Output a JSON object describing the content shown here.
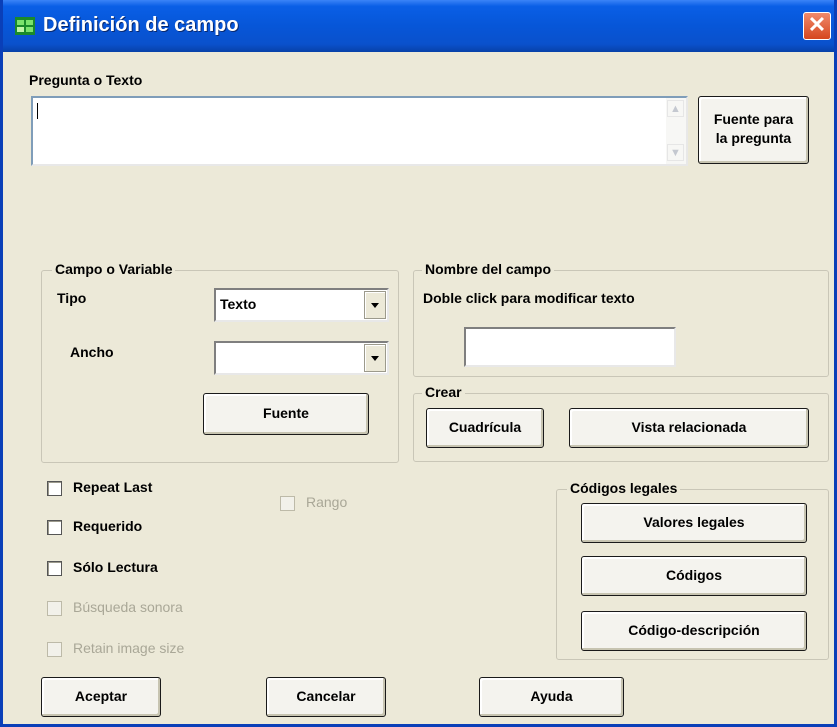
{
  "window": {
    "title": "Definición de campo",
    "close_glyph": "✕"
  },
  "question": {
    "label": "Pregunta o Texto",
    "value": "",
    "font_button_line1": "Fuente para",
    "font_button_line2": "la pregunta"
  },
  "field_group": {
    "legend": "Campo o Variable",
    "type_label": "Tipo",
    "type_value": "Texto",
    "width_label": "Ancho",
    "width_value": "",
    "font_button": "Fuente"
  },
  "name_group": {
    "legend": "Nombre del campo",
    "hint": "Doble click para modificar texto",
    "name_value": ""
  },
  "create_group": {
    "legend": "Crear",
    "grid_button": "Cuadrícula",
    "related_view_button": "Vista relacionada"
  },
  "options": {
    "repeat_last": "Repeat Last",
    "required": "Requerido",
    "read_only": "Sólo Lectura",
    "voice_search": "Búsqueda sonora",
    "retain_image_size": "Retain image size",
    "range": "Rango"
  },
  "codes_group": {
    "legend": "Códigos legales",
    "legal_values_button": "Valores legales",
    "codes_button": "Códigos",
    "code_description_button": "Código-descripción"
  },
  "footer": {
    "accept_button": "Aceptar",
    "cancel_button": "Cancelar",
    "help_button": "Ayuda"
  }
}
